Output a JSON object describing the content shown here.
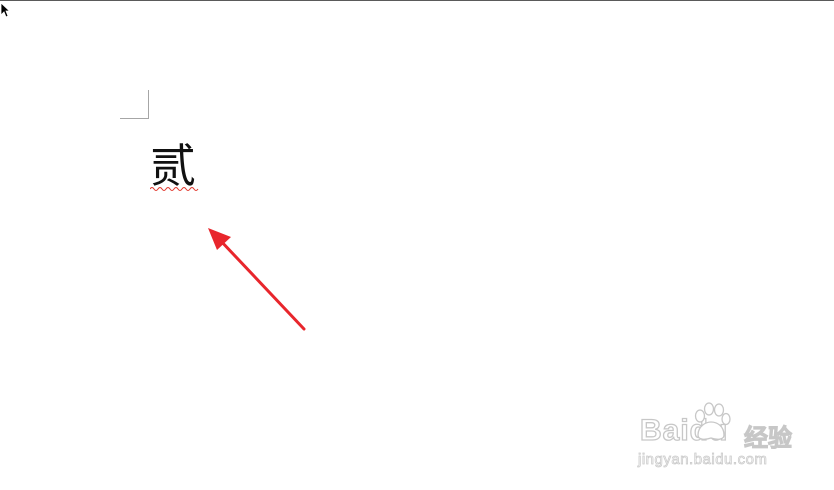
{
  "document": {
    "text": "贰"
  },
  "annotation": {
    "arrow_color": "#e8262c"
  },
  "watermark": {
    "brand": "Baidu",
    "product": "经验",
    "url": "jingyan.baidu.com"
  },
  "icons": {
    "cursor": "arrow-cursor-icon",
    "paw": "baidu-paw-icon"
  }
}
